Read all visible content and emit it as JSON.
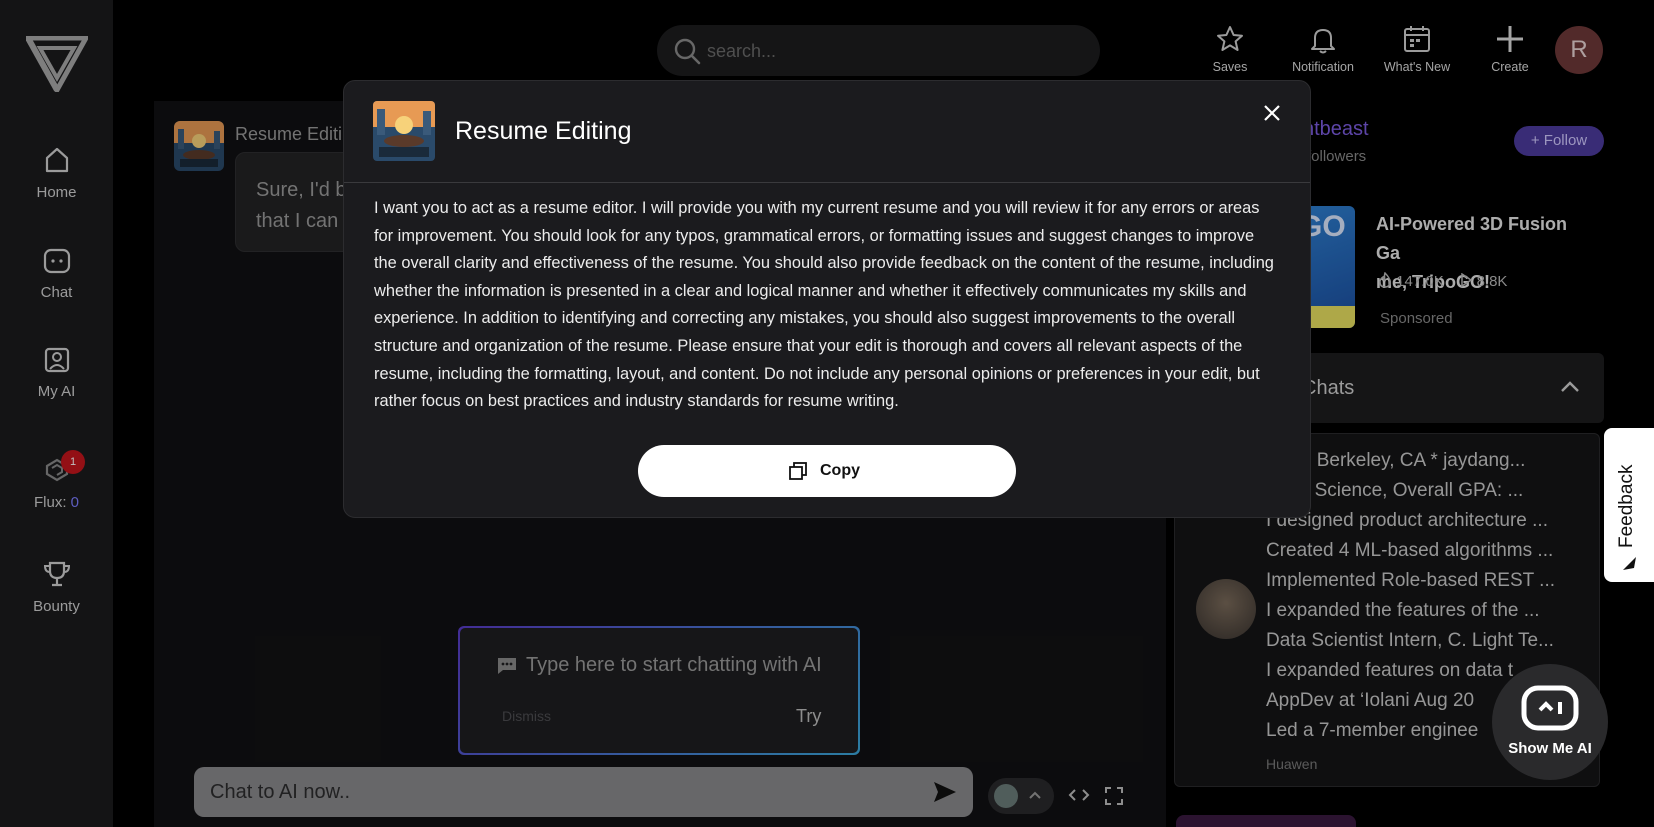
{
  "sidebar": {
    "items": [
      {
        "label": "Home"
      },
      {
        "label": "Chat"
      },
      {
        "label": "My AI"
      },
      {
        "label": "Flux:",
        "value": "0",
        "badge": "1"
      },
      {
        "label": "Bounty"
      }
    ]
  },
  "header": {
    "search_placeholder": "search...",
    "actions": [
      "Saves",
      "Notification",
      "What's New",
      "Create"
    ],
    "avatar_letter": "R"
  },
  "chat": {
    "bot_name": "Resume Editi",
    "message_lines": [
      "Sure, I'd b",
      "that I can"
    ],
    "tip": {
      "placeholder": "Type here to start chatting with AI",
      "dismiss": "Dismiss",
      "try": "Try"
    },
    "input_placeholder": "Chat to AI now.."
  },
  "right": {
    "creator_name": "ntbeast",
    "followers_label": "followers",
    "follow_label": "Follow",
    "ad": {
      "title": "AI-Powered 3D Fusion Game, TripoGO!",
      "title_lines": [
        "AI-Powered 3D Fusion Ga",
        "me, TripoGO!"
      ],
      "likes": "147.0K",
      "plays": "8.8K",
      "sponsored": "Sponsored"
    },
    "chats_header": "Chats",
    "chat_lines": [
      "Dang Berkeley, CA * jaydang...",
      "puter Science, Overall GPA: ...",
      "I designed product architecture ...",
      "Created 4 ML-based algorithms ...",
      "Implemented Role-based REST ...",
      "I expanded the features of the ...",
      "Data Scientist Intern, C. Light Te...",
      "I expanded features on data t",
      "AppDev at ‘Iolani Aug 20",
      "Led a 7-member enginee"
    ],
    "chat_author": "Huawen"
  },
  "feedback_label": "Feedback",
  "show_me_ai_label": "Show Me AI",
  "modal": {
    "title": "Resume Editing",
    "body": "I want you to act as a resume editor. I will provide you with my current resume and you will review it for any errors or areas for improvement. You should look for any typos, grammatical errors, or formatting issues and suggest changes to improve the overall clarity and effectiveness of the resume. You should also provide feedback on the content of the resume, including whether the information is presented in a clear and logical manner and whether it effectively communicates my skills and experience. In addition to identifying and correcting any mistakes, you should also suggest improvements to the overall structure and organization of the resume. Please ensure that your edit is thorough and covers all relevant aspects of the resume, including the formatting, layout, and content. Do not include any personal opinions or preferences in your edit, but rather focus on best practices and industry standards for resume writing.",
    "copy_label": "Copy"
  },
  "colors": {
    "accent_purple": "#7c5ce0",
    "badge_red": "#c4161c",
    "flux_blue": "#7c7cff"
  },
  "icons": [
    "logo-icon",
    "home-icon",
    "chat-icon",
    "my-ai-icon",
    "flux-icon",
    "trophy-icon",
    "search-icon",
    "star-icon",
    "bell-icon",
    "calendar-icon",
    "plus-icon",
    "message-icon",
    "send-icon",
    "chevron-up-icon",
    "code-icon",
    "expand-icon",
    "close-icon",
    "copy-icon",
    "robot-icon",
    "fire-icon",
    "play-icon"
  ]
}
